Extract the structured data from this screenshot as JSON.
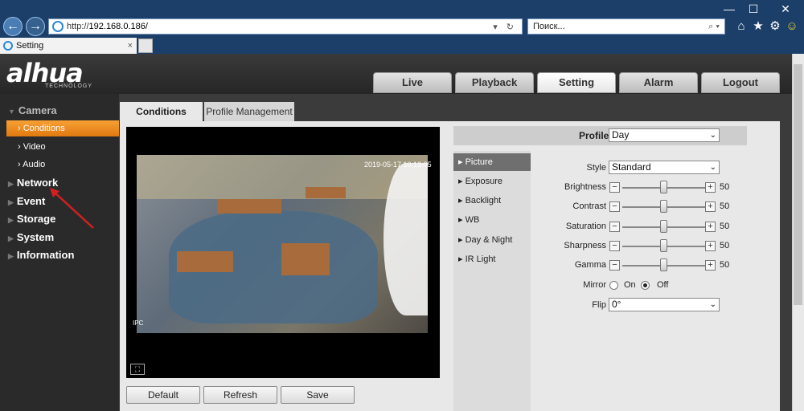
{
  "browser": {
    "url_prefix": "http://",
    "url_host": "192.168.0.186/",
    "address_tools": "▾ ↻",
    "search_placeholder": "Поиск...",
    "search_tools": "⌕ ▾",
    "tab_title": "Setting",
    "tab_close": "×",
    "minimize": "—",
    "maximize": "☐",
    "close": "✕",
    "back": "←",
    "forward": "→",
    "home_icon": "⌂",
    "star_icon": "★",
    "gear_icon": "⚙",
    "smile_icon": "☺"
  },
  "logo": {
    "text": "alhua",
    "sub": "TECHNOLOGY"
  },
  "main_tabs": [
    "Live",
    "Playback",
    "Setting",
    "Alarm",
    "Logout"
  ],
  "active_main_tab": "Setting",
  "sidebar": {
    "camera": "Camera",
    "camera_items": [
      "Conditions",
      "Video",
      "Audio"
    ],
    "sections": [
      "Network",
      "Event",
      "Storage",
      "System",
      "Information"
    ]
  },
  "subtabs": {
    "conditions": "Conditions",
    "profile_management": "Profile Management"
  },
  "video": {
    "timestamp": "2019-05-17 10:13:05",
    "osd": "IPC"
  },
  "buttons": {
    "default": "Default",
    "refresh": "Refresh",
    "save": "Save"
  },
  "profile": {
    "label": "Profile",
    "value": "Day"
  },
  "menu": [
    "Picture",
    "Exposure",
    "Backlight",
    "WB",
    "Day & Night",
    "IR Light"
  ],
  "active_menu": "Picture",
  "picture": {
    "style_label": "Style",
    "style_value": "Standard",
    "sliders": [
      {
        "label": "Brightness",
        "value": 50
      },
      {
        "label": "Contrast",
        "value": 50
      },
      {
        "label": "Saturation",
        "value": 50
      },
      {
        "label": "Sharpness",
        "value": 50
      },
      {
        "label": "Gamma",
        "value": 50
      }
    ],
    "mirror_label": "Mirror",
    "mirror_on": "On",
    "mirror_off": "Off",
    "mirror_value": "Off",
    "flip_label": "Flip",
    "flip_value": "0°"
  },
  "colors": {
    "accent": "#f08a1c",
    "header": "#2a2a2a",
    "browser": "#1c3f6a"
  }
}
